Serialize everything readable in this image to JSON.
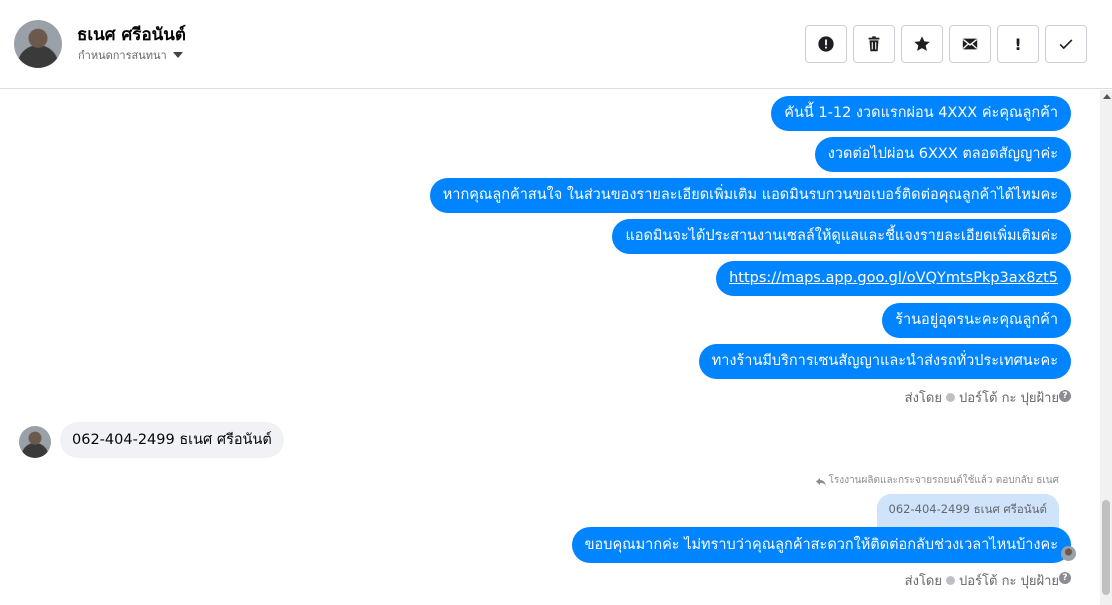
{
  "contact": {
    "name": "ธเนศ ศรีอนันต์",
    "subtitle": "กำหนดการสนทนา"
  },
  "toolbar": {
    "buttons": [
      {
        "icon": "alert-circle-icon",
        "label": "Mark as spam"
      },
      {
        "icon": "trash-icon",
        "label": "Delete"
      },
      {
        "icon": "star-icon",
        "label": "Star"
      },
      {
        "icon": "envelope-icon",
        "label": "Mark as unread"
      },
      {
        "icon": "exclamation-icon",
        "label": "!"
      },
      {
        "icon": "check-icon",
        "label": "Done"
      }
    ]
  },
  "thread": {
    "outgoing_block1": [
      "คันนี้ 1-12  งวดแรกผ่อน 4XXX ค่ะคุณลูกค้า",
      "งวดต่อไปผ่อน 6XXX ตลอดสัญญาค่ะ",
      "หากคุณลูกค้าสนใจ ในส่วนของรายละเอียดเพิ่มเติม แอดมินรบกวนขอเบอร์ติดต่อคุณลูกค้าได้ไหมคะ",
      "แอดมินจะได้ประสานงานเซลล์ให้ดูแลและชี้แจงรายละเอียดเพิ่มเติมค่ะ",
      "https://maps.app.goo.gl/oVQYmtsPkp3ax8zt5",
      "ร้านอยู่อุดรนะคะคุณลูกค้า",
      "ทางร้านมีบริการเซนสัญญาและนำส่งรถทั่วประเทศนะคะ"
    ],
    "sent_by_1": "ส่งโดย",
    "sender_name_1": "ปอร์โต้ กะ ปุยฝ้าย",
    "incoming": "062-404-2499 ธเนศ  ศรีอนันต์",
    "reply_note": "โรงงานผลิตและกระจายรถยนต์ใช้แล้ว ตอบกลับ ธเนศ",
    "quoted": "062-404-2499 ธเนศ ศรีอนันต์",
    "outgoing_reply": "ขอบคุณมากค่ะ ไม่ทราบว่าคุณลูกค้าสะดวกให้ติดต่อกลับช่วงเวลาไหนบ้างคะ",
    "sent_by_2": "ส่งโดย",
    "sender_name_2": "ปอร์โต้ กะ ปุยฝ้าย",
    "help_icon": "?"
  },
  "colors": {
    "outgoing_bubble": "#0084ff",
    "incoming_bubble": "#f0f2f5",
    "quote_bubble": "#cfe3fb"
  }
}
